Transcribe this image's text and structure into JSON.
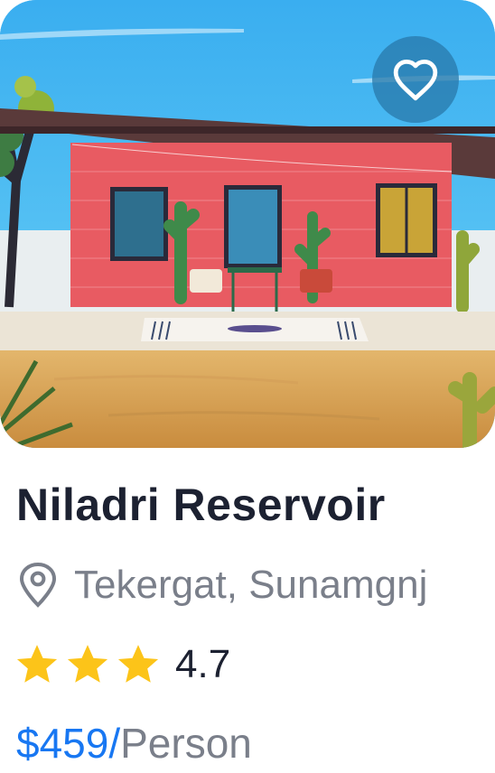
{
  "listing": {
    "title": "Niladri Reservoir",
    "location": "Tekergat, Sunamgnj",
    "rating": "4.7",
    "stars_filled": 3,
    "price": "$459/",
    "price_unit": "Person"
  },
  "icons": {
    "favorite": "heart-icon",
    "location": "map-pin-icon",
    "star": "star-icon"
  },
  "colors": {
    "price": "#1877f2",
    "star": "#fcc419",
    "title": "#1c2131",
    "muted": "#7a7f8a"
  }
}
